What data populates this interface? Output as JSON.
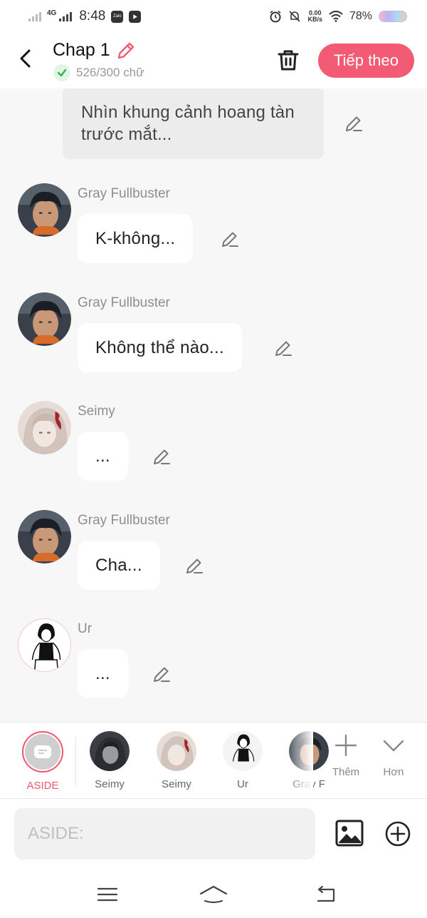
{
  "status_bar": {
    "network": "4G",
    "time": "8:48",
    "app_badge_1": "Zalo",
    "app_badge_2": "",
    "speed_value": "0.00",
    "speed_unit": "KB/s",
    "battery": "78%"
  },
  "header": {
    "title": "Chap 1",
    "word_count": "526/300 chữ",
    "next_label": "Tiếp theo"
  },
  "chat": {
    "narration": "Nhìn khung cảnh hoang tàn trước mắt...",
    "messages": [
      {
        "speaker": "Gray Fullbuster",
        "text": "K-không..."
      },
      {
        "speaker": "Gray Fullbuster",
        "text": "Không thể nào..."
      },
      {
        "speaker": "Seimy",
        "text": "..."
      },
      {
        "speaker": "Gray Fullbuster",
        "text": "Cha..."
      },
      {
        "speaker": "Ur",
        "text": "..."
      }
    ]
  },
  "characters": {
    "aside_label": "ASIDE",
    "items": [
      {
        "label": "Seimy"
      },
      {
        "label": "Seimy"
      },
      {
        "label": "Ur"
      },
      {
        "label": "Gray F"
      }
    ],
    "add_label": "Thêm",
    "more_label": "Hơn"
  },
  "composer": {
    "placeholder": "ASIDE:",
    "value": ""
  },
  "colors": {
    "accent": "#f25b73",
    "bubble": "#ffffff",
    "background": "#f7f7f7",
    "narration_bg": "#ececec",
    "speaker_text": "#8e8e8e"
  },
  "icons": {
    "back": "chevron-left-icon",
    "title_edit": "pencil-icon",
    "word_ok": "check-icon",
    "delete": "trash-icon",
    "edit": "pencil-icon",
    "add": "plus-icon",
    "more": "chevron-down-icon",
    "image": "image-icon",
    "insert": "plus-circle-icon",
    "nav_menu": "menu-icon",
    "nav_home": "home-icon",
    "nav_back": "back-icon"
  }
}
